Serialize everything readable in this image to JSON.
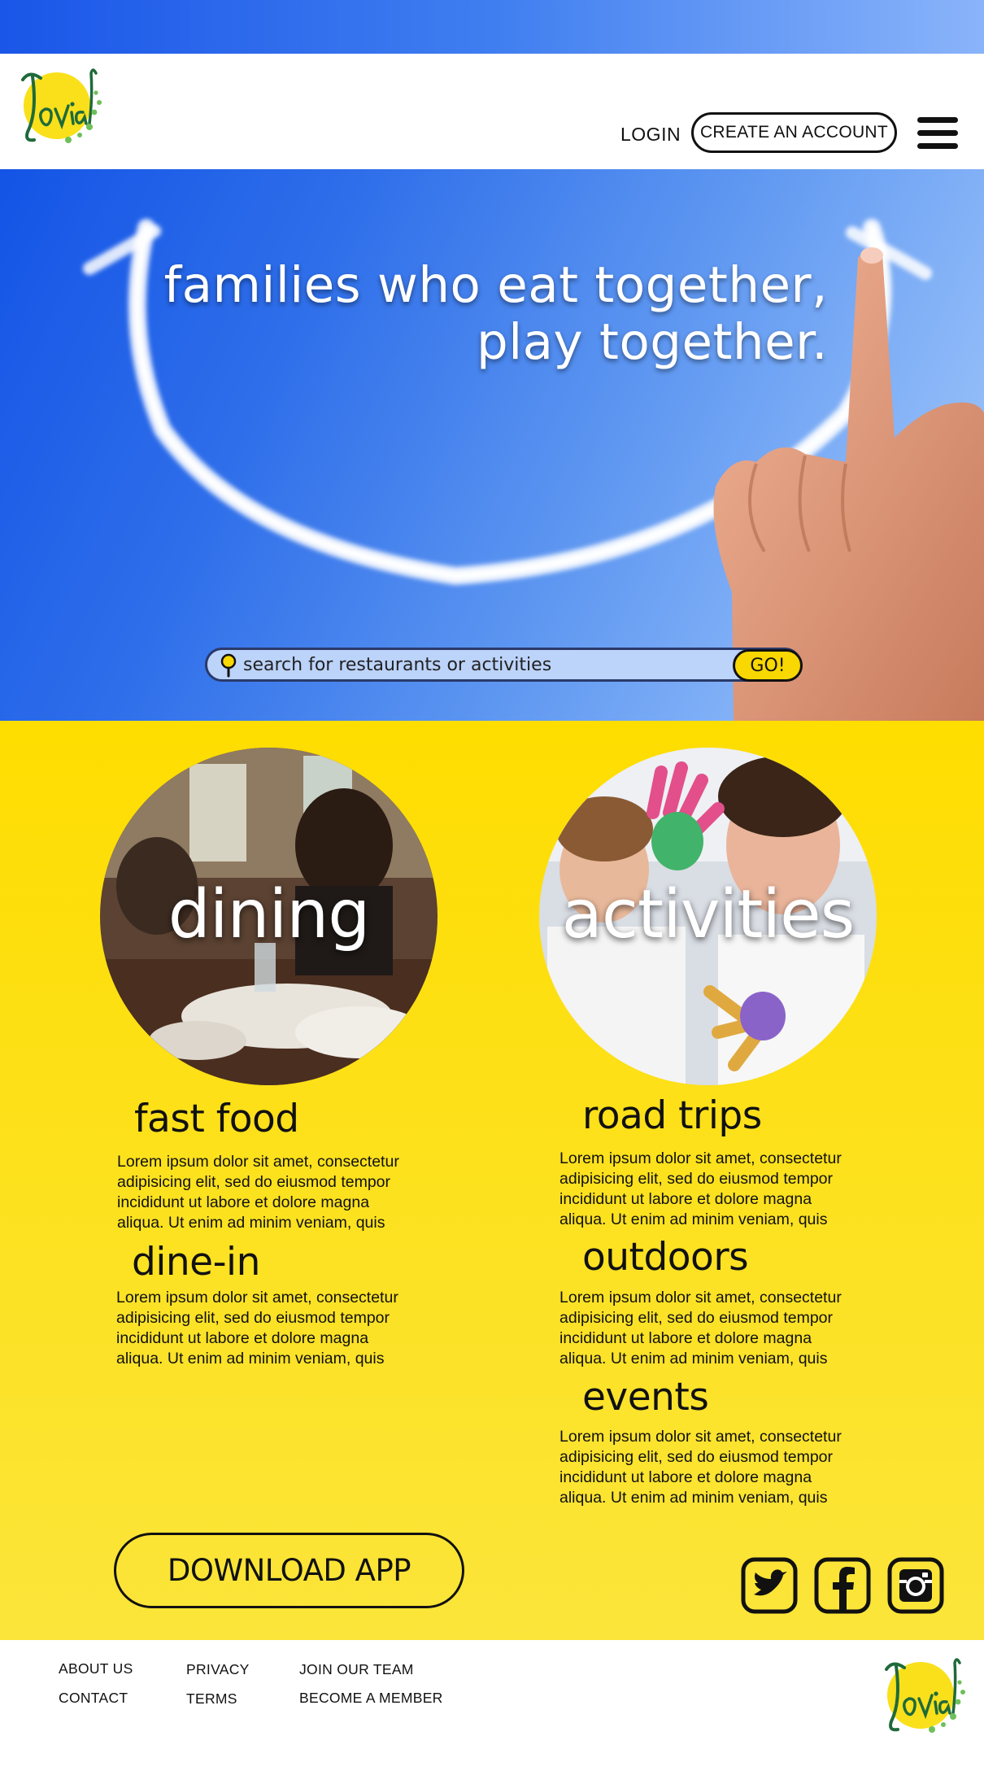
{
  "brand": {
    "name": "Jovial"
  },
  "header": {
    "login_label": "LOGIN",
    "create_account_label": "CREATE AN ACCOUNT"
  },
  "hero": {
    "tagline_line1": "families who eat together,",
    "tagline_line2": "play together.",
    "search_placeholder": "search for restaurants or activities",
    "go_label": "GO!"
  },
  "categories": [
    {
      "label": "dining"
    },
    {
      "label": "activities"
    }
  ],
  "dining_sections": [
    {
      "title": "fast food",
      "text": "Lorem ipsum dolor sit amet, consectetur adipisicing elit, sed do eiusmod tempor incididunt ut labore et dolore magna aliqua. Ut enim ad minim veniam, quis"
    },
    {
      "title": "dine-in",
      "text": "Lorem ipsum dolor sit amet, consectetur adipisicing elit, sed do eiusmod tempor incididunt ut labore et dolore magna aliqua. Ut enim ad minim veniam, quis"
    }
  ],
  "activity_sections": [
    {
      "title": "road trips",
      "text": "Lorem ipsum dolor sit amet, consectetur adipisicing elit, sed do eiusmod tempor incididunt ut labore et dolore magna aliqua. Ut enim ad minim veniam, quis"
    },
    {
      "title": "outdoors",
      "text": "Lorem ipsum dolor sit amet, consectetur adipisicing elit, sed do eiusmod tempor incididunt ut labore et dolore magna aliqua. Ut enim ad minim veniam, quis"
    },
    {
      "title": "events",
      "text": "Lorem ipsum dolor sit amet, consectetur adipisicing elit, sed do eiusmod tempor incididunt ut labore et dolore magna aliqua. Ut enim ad minim veniam, quis"
    }
  ],
  "download_label": "DOWNLOAD APP",
  "social": [
    "twitter-icon",
    "facebook-icon",
    "instagram-icon"
  ],
  "footer": {
    "about_us": "ABOUT US",
    "contact": "CONTACT",
    "privacy": "PRIVACY",
    "terms": "TERMS",
    "join_our_team": "JOIN OUR TEAM",
    "become_a_member": "BECOME A MEMBER"
  },
  "colors": {
    "accent_yellow": "#fedd00",
    "sky_blue": "#2f6fea",
    "brand_green": "#1f7a3a"
  }
}
